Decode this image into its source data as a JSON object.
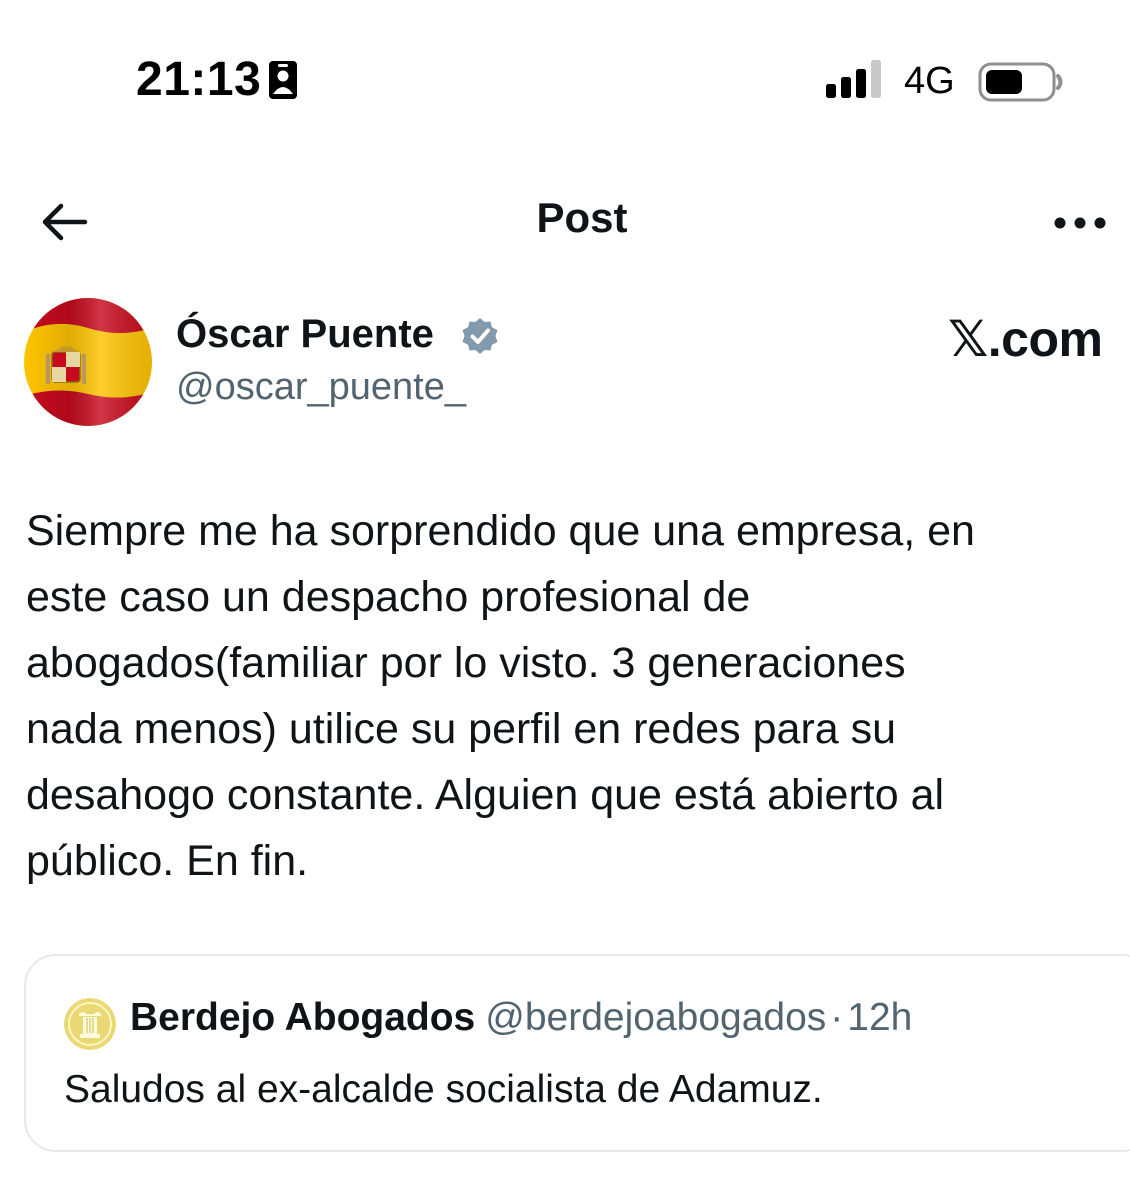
{
  "status_bar": {
    "time": "21:13",
    "network": "4G",
    "icons": {
      "badge": "id-card-icon",
      "signal": "cellular-signal-icon",
      "battery": "battery-icon"
    }
  },
  "nav": {
    "title": "Post",
    "back_icon": "arrow-left-icon",
    "more_icon": "more-horizontal-icon"
  },
  "author": {
    "name": "Óscar Puente",
    "handle": "@oscar_puente_",
    "verified": true,
    "avatar_icon": "spain-flag-avatar"
  },
  "watermark": "𝕏.com",
  "post": {
    "lines": [
      "Siempre me ha sorprendido que una empresa, en",
      "este caso un despacho profesional de",
      "abogados(familiar por lo visto. 3 generaciones",
      "nada menos) utilice su perfil en redes para su",
      "desahogo constante. Alguien que está abierto al",
      "público. En fin."
    ]
  },
  "quoted_post": {
    "name": "Berdejo Abogados",
    "handle": "@berdejoabogados",
    "separator": "·",
    "time": "12h",
    "text": "Saludos al ex-alcalde socialista de Adamuz.",
    "avatar_icon": "column-logo-avatar"
  },
  "colors": {
    "text_primary": "#0f1419",
    "text_secondary": "#536471",
    "verified_badge": "#829aab",
    "border": "#e6e9eb",
    "flag_red": "#c60b1e",
    "flag_yellow": "#ffc400"
  }
}
